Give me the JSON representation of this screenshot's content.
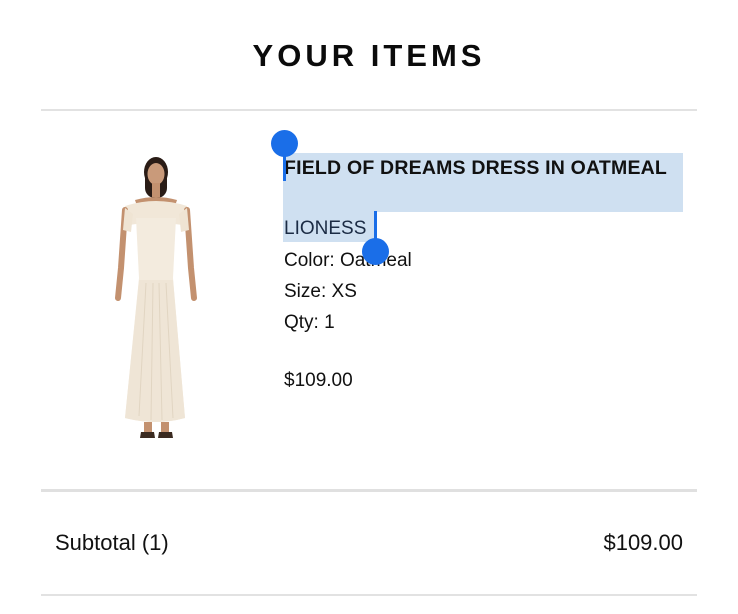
{
  "header": {
    "title": "YOUR ITEMS"
  },
  "item": {
    "name": "FIELD OF DREAMS DRESS IN OATMEAL",
    "brand": "LIONESS",
    "color": "Color: Oatmeal",
    "size": "Size: XS",
    "qty": "Qty: 1",
    "price": "$109.00",
    "image_icon": "dress-product-image"
  },
  "summary": {
    "subtotal_label": "Subtotal (1)",
    "subtotal_value": "$109.00"
  },
  "colors": {
    "selection_highlight": "#cfe0f1",
    "selection_handle": "#1a6ee8",
    "divider": "#e2e2e2"
  }
}
